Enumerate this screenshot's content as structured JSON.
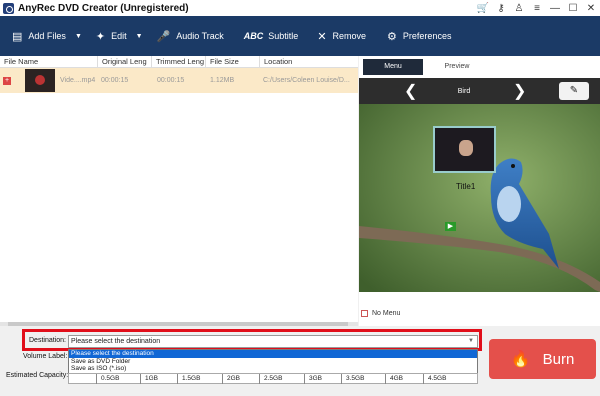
{
  "window": {
    "title": "AnyRec DVD Creator (Unregistered)",
    "icons": [
      "cart-icon",
      "key-icon",
      "user-icon",
      "menu-icon",
      "minimize-icon",
      "maximize-icon",
      "close-icon"
    ]
  },
  "toolbar": {
    "add_files": "Add Files",
    "edit": "Edit",
    "audio_track": "Audio Track",
    "subtitle_abc": "ABC",
    "subtitle": "Subtitle",
    "remove": "Remove",
    "preferences": "Preferences"
  },
  "file_list": {
    "columns": [
      "File Name",
      "Original Leng",
      "Trimmed Leng",
      "File Size",
      "Location"
    ],
    "rows": [
      {
        "name": "Vide....mp4",
        "original_length": "00:00:15",
        "trimmed_length": "00:00:15",
        "size": "1.12MB",
        "location": "C:/Users/Coleen Louise/D..."
      }
    ]
  },
  "preview": {
    "tabs": [
      "Menu",
      "Preview"
    ],
    "theme": "Bird",
    "chapter_title": "Title1",
    "no_menu": "No Menu"
  },
  "destination": {
    "label": "Destination:",
    "value": "Please select the destination",
    "options": [
      "Please select the destination",
      "Save as DVD Folder",
      "Save as ISO (*.iso)"
    ]
  },
  "volume_label": "Volume Label:",
  "capacity": {
    "label": "Estimated Capacity:",
    "ticks": [
      "0.5GB",
      "1GB",
      "1.5GB",
      "2GB",
      "2.5GB",
      "3GB",
      "3.5GB",
      "4GB",
      "4.5GB"
    ]
  },
  "burn_label": "Burn",
  "colors": {
    "toolbar": "#1b3a66",
    "row_highlight": "#fbe9c8",
    "dest_highlight": "#e10e1a",
    "burn": "#e4504b",
    "selected_option": "#1067d5"
  }
}
